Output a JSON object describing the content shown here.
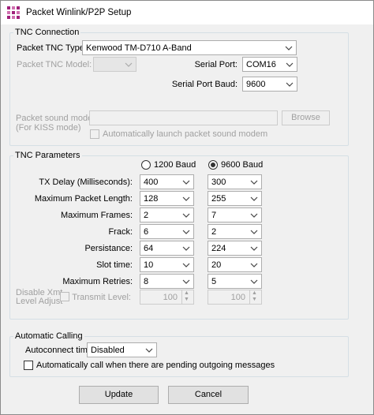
{
  "window": {
    "title": "Packet Winlink/P2P Setup",
    "icon": "winlink-grid-icon"
  },
  "tnc_connection": {
    "group_label": "TNC Connection",
    "tnc_type_label": "Packet TNC Type:",
    "tnc_type_value": "Kenwood TM-D710 A-Band",
    "tnc_model_label": "Packet TNC Model:",
    "tnc_model_value": "",
    "serial_port_label": "Serial Port:",
    "serial_port_value": "COM16",
    "serial_baud_label": "Serial Port Baud:",
    "serial_baud_value": "9600",
    "sound_modem_label": "Packet sound modem:",
    "sound_modem_sub_label": "(For KISS mode)",
    "sound_modem_value": "",
    "browse_label": "Browse",
    "auto_launch_label": "Automatically launch packet sound modem"
  },
  "tnc_parameters": {
    "group_label": "TNC Parameters",
    "baud_1200_label": "1200 Baud",
    "baud_9600_label": "9600 Baud",
    "selected_baud": "9600 Baud",
    "rows": [
      {
        "label": "TX Delay (Milliseconds):",
        "v1200": "400",
        "v9600": "300"
      },
      {
        "label": "Maximum Packet Length:",
        "v1200": "128",
        "v9600": "255"
      },
      {
        "label": "Maximum Frames:",
        "v1200": "2",
        "v9600": "7"
      },
      {
        "label": "Frack:",
        "v1200": "6",
        "v9600": "2"
      },
      {
        "label": "Persistance:",
        "v1200": "64",
        "v9600": "224"
      },
      {
        "label": "Slot time:",
        "v1200": "10",
        "v9600": "20"
      },
      {
        "label": "Maximum Retries:",
        "v1200": "8",
        "v9600": "5"
      }
    ],
    "disable_xmt_label_1": "Disable Xmt",
    "disable_xmt_label_2": "Level Adjust",
    "transmit_level_label": "Transmit Level:",
    "transmit_level_1200": "100",
    "transmit_level_9600": "100"
  },
  "automatic_calling": {
    "group_label": "Automatic Calling",
    "autoconnect_label": "Autoconnect time:",
    "autoconnect_value": "Disabled",
    "auto_call_label": "Automatically call when there are pending outgoing messages"
  },
  "buttons": {
    "update_label": "Update",
    "cancel_label": "Cancel"
  }
}
